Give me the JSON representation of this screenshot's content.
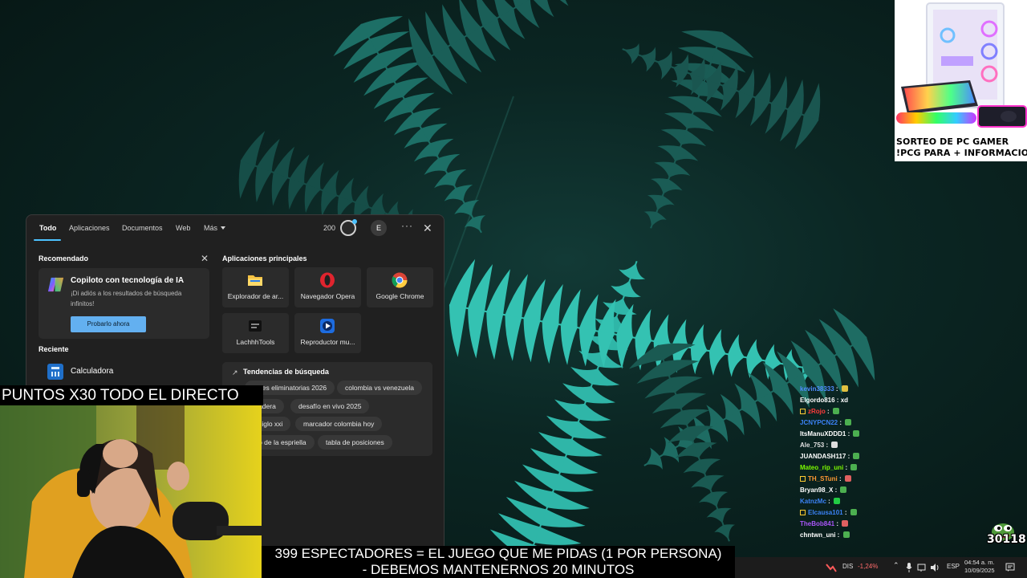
{
  "giveaway": {
    "line1": "SORTEO DE PC GAMER",
    "line2": "!PCG PARA + INFORMACION"
  },
  "search": {
    "tabs": [
      "Todo",
      "Aplicaciones",
      "Documentos",
      "Web",
      "Más"
    ],
    "points": "200",
    "avatar_initial": "E",
    "more_dots": "···",
    "close": "✕",
    "recommended": {
      "title": "Recomendado",
      "card_title": "Copiloto con tecnología de IA",
      "card_desc": "¡Di adiós a los resultados de búsqueda infinitos!",
      "button": "Probarlo ahora"
    },
    "recent": {
      "title": "Reciente",
      "items": [
        "Calculadora"
      ]
    },
    "top_apps": {
      "title": "Aplicaciones principales",
      "apps": [
        "Explorador de ar...",
        "Navegador Opera",
        "Google Chrome",
        "LachhhTools",
        "Reproductor mu..."
      ]
    },
    "trends": {
      "title": "Tendencias de búsqueda",
      "chips": [
        "...nes eliminatorias 2026",
        "colombia vs venezuela",
        "...adera",
        "desafío en vivo 2025",
        "...siglo xxi",
        "marcador colombia hoy",
        "...o de la espriella",
        "tabla de posiciones"
      ]
    }
  },
  "overlay": {
    "cam_banner": "PUNTOS X30 TODO EL DIRECTO",
    "bottom_line1": "399 ESPECTADORES = EL JUEGO QUE ME PIDAS (1 POR PERSONA)",
    "bottom_line2": "- DEBEMOS MANTENERNOS 20 MINUTOS",
    "pepe_count": "30118"
  },
  "chat": [
    {
      "user": "kevin38333",
      "msg": "",
      "color": "#4f8cff",
      "emote": "#e0c040"
    },
    {
      "user": "Elgordo816",
      "msg": "xd",
      "color": "#ffffff",
      "emote": ""
    },
    {
      "user": "zRojo",
      "msg": "",
      "color": "#ff3b3b",
      "emote": "#4caf50",
      "badge": true
    },
    {
      "user": "JCNYPCN22",
      "msg": "",
      "color": "#3b82f6",
      "emote": "#4caf50"
    },
    {
      "user": "ItsManuXDDD1",
      "msg": "",
      "color": "#ffffff",
      "emote": "#4caf50"
    },
    {
      "user": "Ale_753",
      "msg": "",
      "color": "#e0e0e0",
      "emote": "#dddddd"
    },
    {
      "user": "JUANDASH117",
      "msg": "",
      "color": "#ffffff",
      "emote": "#4caf50"
    },
    {
      "user": "Mateo_rip_uni",
      "msg": "",
      "color": "#7CFC00",
      "emote": "#4caf50"
    },
    {
      "user": "TH_STuni",
      "msg": "",
      "color": "#ff9933",
      "emote": "#e06060",
      "badge": true
    },
    {
      "user": "Bryan98_X",
      "msg": "",
      "color": "#ffffff",
      "emote": "#4caf50"
    },
    {
      "user": "KatnzMc",
      "msg": "",
      "color": "#3b82f6",
      "emote": "#22cc44"
    },
    {
      "user": "Elcausa101",
      "msg": "",
      "color": "#3b82f6",
      "emote": "#4caf50",
      "badge": true
    },
    {
      "user": "TheBob841",
      "msg": "",
      "color": "#a855f7",
      "emote": "#e06060"
    },
    {
      "user": "chntwn_uni",
      "msg": "",
      "color": "#ffffff",
      "emote": "#4caf50"
    }
  ],
  "taskbar": {
    "stock_name": "DIS",
    "stock_change": "-1,24%",
    "lang": "ESP",
    "time": "04:54 a. m.",
    "date": "10/09/2025"
  }
}
